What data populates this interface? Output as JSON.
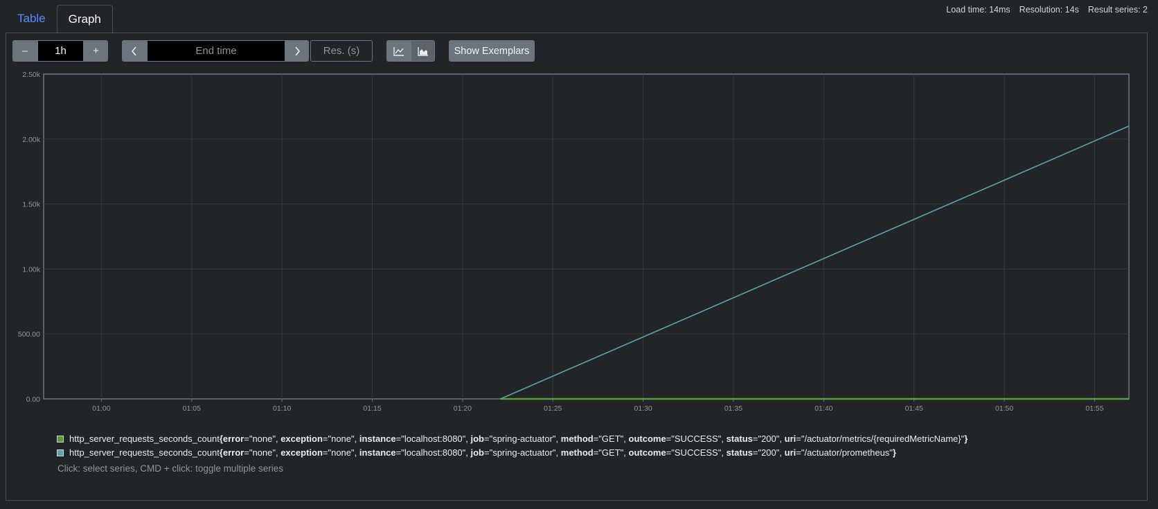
{
  "tabs": {
    "table": "Table",
    "graph": "Graph"
  },
  "stats": {
    "load_time": "Load time: 14ms",
    "resolution": "Resolution: 14s",
    "result_series": "Result series: 2"
  },
  "controls": {
    "minus_label": "–",
    "range_value": "1h",
    "plus_label": "+",
    "prev_label": "‹",
    "end_time_placeholder": "End time",
    "next_label": "›",
    "resolution_placeholder": "Res. (s)",
    "line_chart_icon": "line-chart-icon",
    "stacked_chart_icon": "area-chart-icon",
    "exemplars_label": "Show Exemplars"
  },
  "chart_data": {
    "type": "line",
    "xlabel": "",
    "ylabel": "",
    "x_ticks": [
      "01:00",
      "01:05",
      "01:10",
      "01:15",
      "01:20",
      "01:25",
      "01:30",
      "01:35",
      "01:40",
      "01:45",
      "01:50",
      "01:55"
    ],
    "y_ticks": [
      "0.00",
      "500.00",
      "1.00k",
      "1.50k",
      "2.00k",
      "2.50k"
    ],
    "x_range_minutes": [
      56.8,
      116.9
    ],
    "ylim": [
      0,
      2500
    ],
    "grid": true,
    "series": [
      {
        "color": "#5d9b3a",
        "x_minutes": [
          82.1,
          116.9
        ],
        "values": [
          0,
          0
        ]
      },
      {
        "color": "#5ba3a8",
        "x_minutes": [
          82.1,
          116.9
        ],
        "values": [
          0,
          2100
        ]
      }
    ]
  },
  "legend": [
    {
      "color": "#5d9b3a",
      "metric": "http_server_requests_seconds_count",
      "labels": [
        {
          "k": "error",
          "v": "\"none\""
        },
        {
          "k": "exception",
          "v": "\"none\""
        },
        {
          "k": "instance",
          "v": "\"localhost:8080\""
        },
        {
          "k": "job",
          "v": "\"spring-actuator\""
        },
        {
          "k": "method",
          "v": "\"GET\""
        },
        {
          "k": "outcome",
          "v": "\"SUCCESS\""
        },
        {
          "k": "status",
          "v": "\"200\""
        },
        {
          "k": "uri",
          "v": "\"/actuator/metrics/{requiredMetricName}\""
        }
      ]
    },
    {
      "color": "#5ba3a8",
      "metric": "http_server_requests_seconds_count",
      "labels": [
        {
          "k": "error",
          "v": "\"none\""
        },
        {
          "k": "exception",
          "v": "\"none\""
        },
        {
          "k": "instance",
          "v": "\"localhost:8080\""
        },
        {
          "k": "job",
          "v": "\"spring-actuator\""
        },
        {
          "k": "method",
          "v": "\"GET\""
        },
        {
          "k": "outcome",
          "v": "\"SUCCESS\""
        },
        {
          "k": "status",
          "v": "\"200\""
        },
        {
          "k": "uri",
          "v": "\"/actuator/prometheus\""
        }
      ]
    }
  ],
  "hint": "Click: select series, CMD + click: toggle multiple series"
}
